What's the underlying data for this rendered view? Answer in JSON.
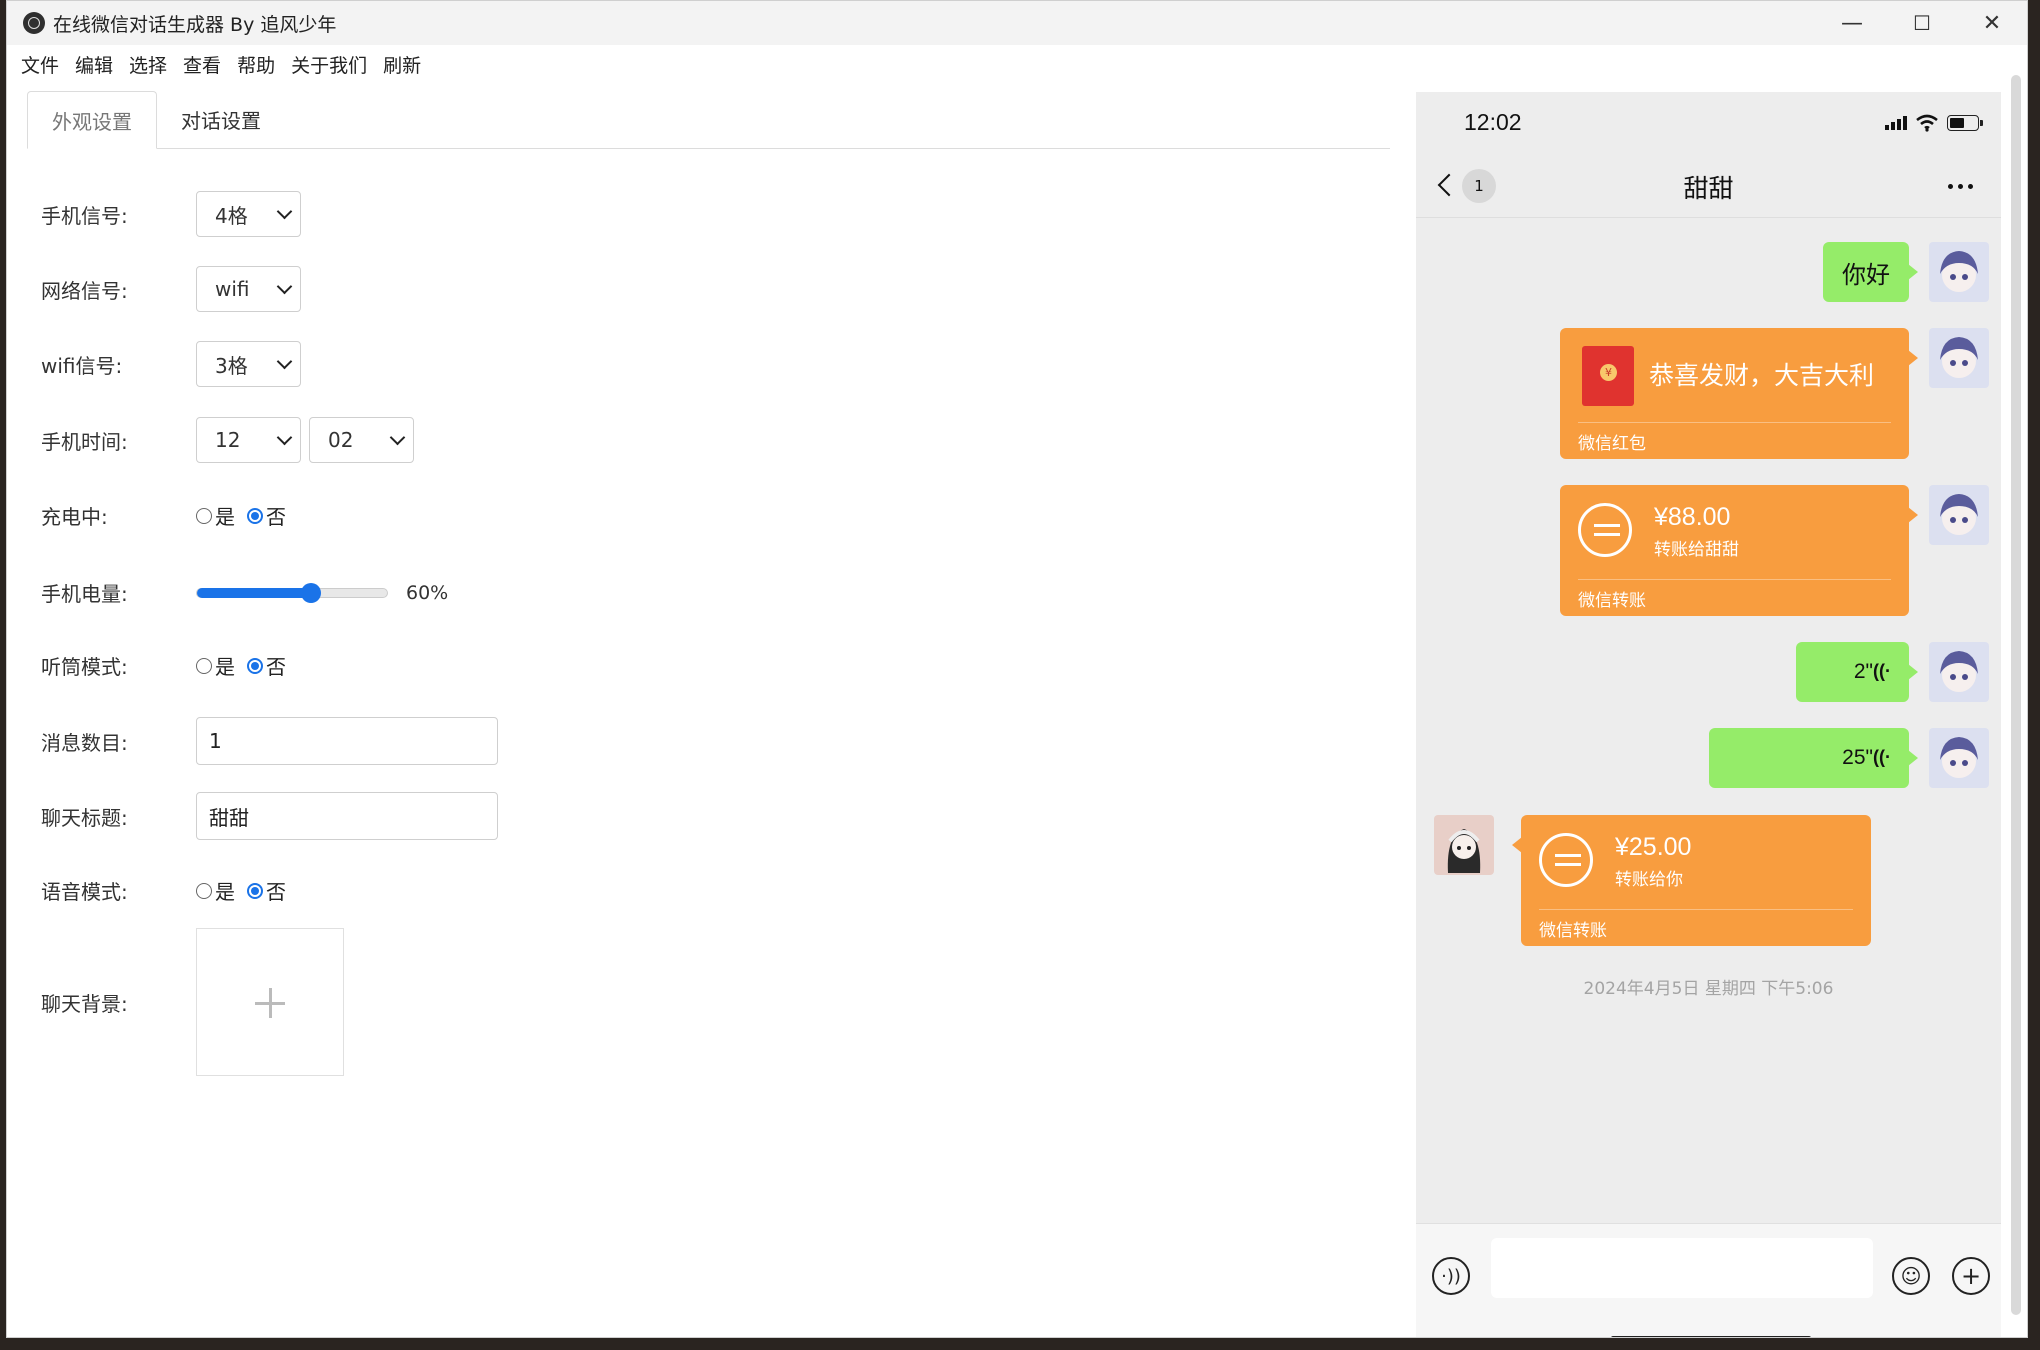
{
  "window": {
    "title": "在线微信对话生成器 By 追风少年",
    "min": "—",
    "max": "☐",
    "close": "✕"
  },
  "menu": [
    "文件",
    "编辑",
    "选择",
    "查看",
    "帮助",
    "关于我们",
    "刷新"
  ],
  "tabs": [
    {
      "label": "外观设置",
      "active": true
    },
    {
      "label": "对话设置",
      "active": false
    }
  ],
  "form": {
    "phone_signal": {
      "label": "手机信号:",
      "value": "4格"
    },
    "network_signal": {
      "label": "网络信号:",
      "value": "wifi"
    },
    "wifi_signal": {
      "label": "wifi信号:",
      "value": "3格"
    },
    "phone_time": {
      "label": "手机时间:",
      "hour": "12",
      "minute": "02"
    },
    "charging": {
      "label": "充电中:",
      "yes": "是",
      "no": "否",
      "selected": "否"
    },
    "battery": {
      "label": "手机电量:",
      "value": 60,
      "display": "60%"
    },
    "earpiece": {
      "label": "听筒模式:",
      "yes": "是",
      "no": "否",
      "selected": "否"
    },
    "message_count": {
      "label": "消息数目:",
      "value": "1"
    },
    "chat_title": {
      "label": "聊天标题:",
      "value": "甜甜"
    },
    "voice_mode": {
      "label": "语音模式:",
      "yes": "是",
      "no": "否",
      "selected": "否"
    },
    "chat_bg": {
      "label": "聊天背景:"
    }
  },
  "phone": {
    "time": "12:02",
    "unread": "1",
    "title": "甜甜",
    "messages": {
      "hello": "你好",
      "red_packet": {
        "text": "恭喜发财，大吉大利",
        "footer": "微信红包",
        "coin": "¥"
      },
      "transfer_out": {
        "amount": "¥88.00",
        "note": "转账给甜甜",
        "footer": "微信转账"
      },
      "voice1": "2\"",
      "voice2": "25\"",
      "transfer_in": {
        "amount": "¥25.00",
        "note": "转账给你",
        "footer": "微信转账"
      }
    },
    "timestamp": "2024年4月5日 星期四 下午5:06"
  },
  "colors": {
    "green_bubble": "#95ec69",
    "orange_card": "#f89d3f",
    "accent": "#1a73e8",
    "chat_bg": "#ededed"
  }
}
